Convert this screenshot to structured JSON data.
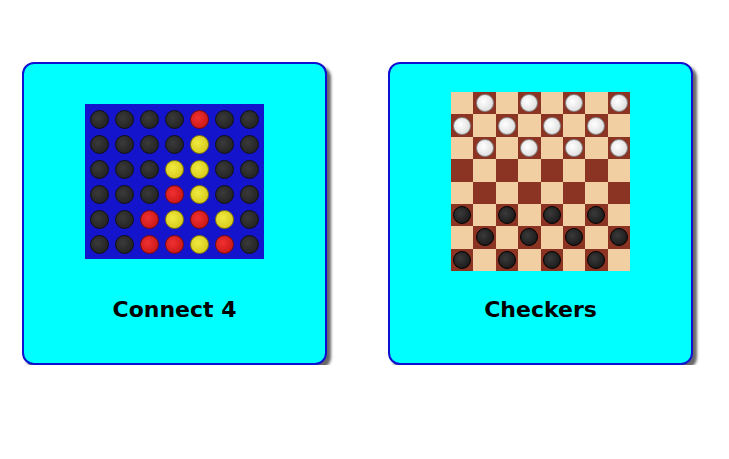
{
  "cards": [
    {
      "title": "Connect 4",
      "kind": "connect4",
      "board": [
        [
          "e",
          "e",
          "e",
          "e",
          "r",
          "e",
          "e"
        ],
        [
          "e",
          "e",
          "e",
          "e",
          "y",
          "e",
          "e"
        ],
        [
          "e",
          "e",
          "e",
          "y",
          "y",
          "e",
          "e"
        ],
        [
          "e",
          "e",
          "e",
          "r",
          "y",
          "e",
          "e"
        ],
        [
          "e",
          "e",
          "r",
          "y",
          "r",
          "y",
          "e"
        ],
        [
          "e",
          "e",
          "r",
          "r",
          "y",
          "r",
          "e"
        ]
      ]
    },
    {
      "title": "Checkers",
      "kind": "checkers",
      "board": [
        [
          "e",
          "w",
          "e",
          "w",
          "e",
          "w",
          "e",
          "w"
        ],
        [
          "w",
          "e",
          "w",
          "e",
          "w",
          "e",
          "w",
          "e"
        ],
        [
          "e",
          "w",
          "e",
          "w",
          "e",
          "w",
          "e",
          "w"
        ],
        [
          "e",
          "e",
          "e",
          "e",
          "e",
          "e",
          "e",
          "e"
        ],
        [
          "e",
          "e",
          "e",
          "e",
          "e",
          "e",
          "e",
          "e"
        ],
        [
          "b",
          "e",
          "b",
          "e",
          "b",
          "e",
          "b",
          "e"
        ],
        [
          "e",
          "b",
          "e",
          "b",
          "e",
          "b",
          "e",
          "b"
        ],
        [
          "b",
          "e",
          "b",
          "e",
          "b",
          "e",
          "b",
          "e"
        ]
      ]
    }
  ]
}
